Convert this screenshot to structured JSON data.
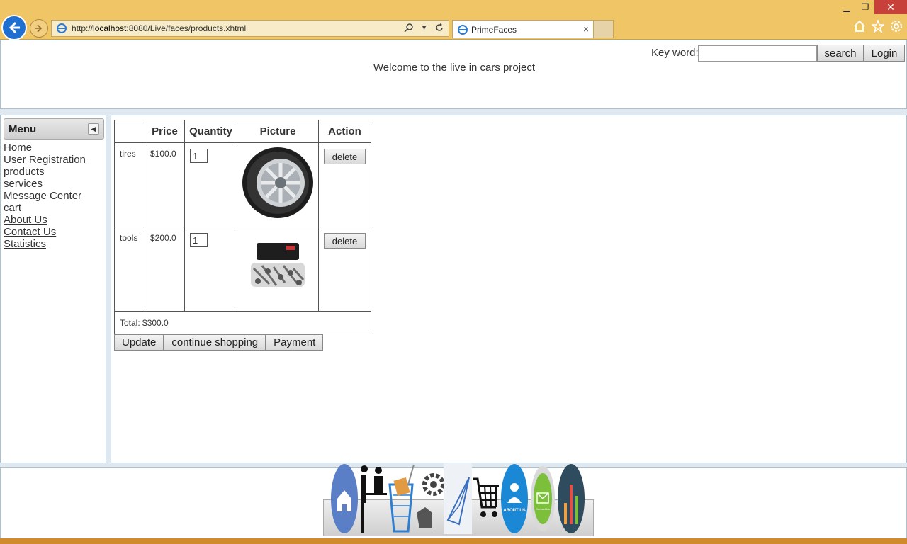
{
  "browser": {
    "url_prefix": "http://",
    "url_host": "localhost",
    "url_path": ":8080/Live/faces/products.xhtml",
    "tab_title": "PrimeFaces",
    "tab_close": "×"
  },
  "header": {
    "keyword_label": "Key word:",
    "keyword_value": "",
    "search_label": "search",
    "login_label": "Login",
    "welcome": "Welcome to the live in cars project"
  },
  "menu": {
    "title": "Menu",
    "items": [
      {
        "label": "Home"
      },
      {
        "label": "User Registration"
      },
      {
        "label": "products"
      },
      {
        "label": "services"
      },
      {
        "label": "Message Center"
      },
      {
        "label": "cart"
      },
      {
        "label": "About Us"
      },
      {
        "label": "Contact Us"
      },
      {
        "label": "Statistics"
      }
    ]
  },
  "cart": {
    "headers": [
      "",
      "Price",
      "Quantity",
      "Picture",
      "Action"
    ],
    "rows": [
      {
        "name": "tires",
        "price": "$100.0",
        "quantity": "1",
        "action": "delete",
        "picture_icon": "tire-icon"
      },
      {
        "name": "tools",
        "price": "$200.0",
        "quantity": "1",
        "action": "delete",
        "picture_icon": "toolkit-icon"
      }
    ],
    "total": "Total: $300.0"
  },
  "actions": {
    "update": "Update",
    "continue": "continue shopping",
    "payment": "Payment"
  },
  "dock": [
    {
      "icon": "home-icon",
      "color": "#5b7fc7"
    },
    {
      "icon": "registration-icon",
      "color": "#111111"
    },
    {
      "icon": "products-basket-icon",
      "color": "#2f7fd1"
    },
    {
      "icon": "services-gear-icon",
      "color": "#444444"
    },
    {
      "icon": "message-envelope-icon",
      "color": "#3a6fbf"
    },
    {
      "icon": "cart-icon",
      "color": "#111111"
    },
    {
      "icon": "about-us-icon",
      "color": "#1b88d6"
    },
    {
      "icon": "contact-us-icon",
      "color": "#7bbf3a"
    },
    {
      "icon": "statistics-icon",
      "color": "#2f4b5e"
    }
  ],
  "dock_text": {
    "about": "ABOUT US",
    "contact": "Contact Us"
  }
}
